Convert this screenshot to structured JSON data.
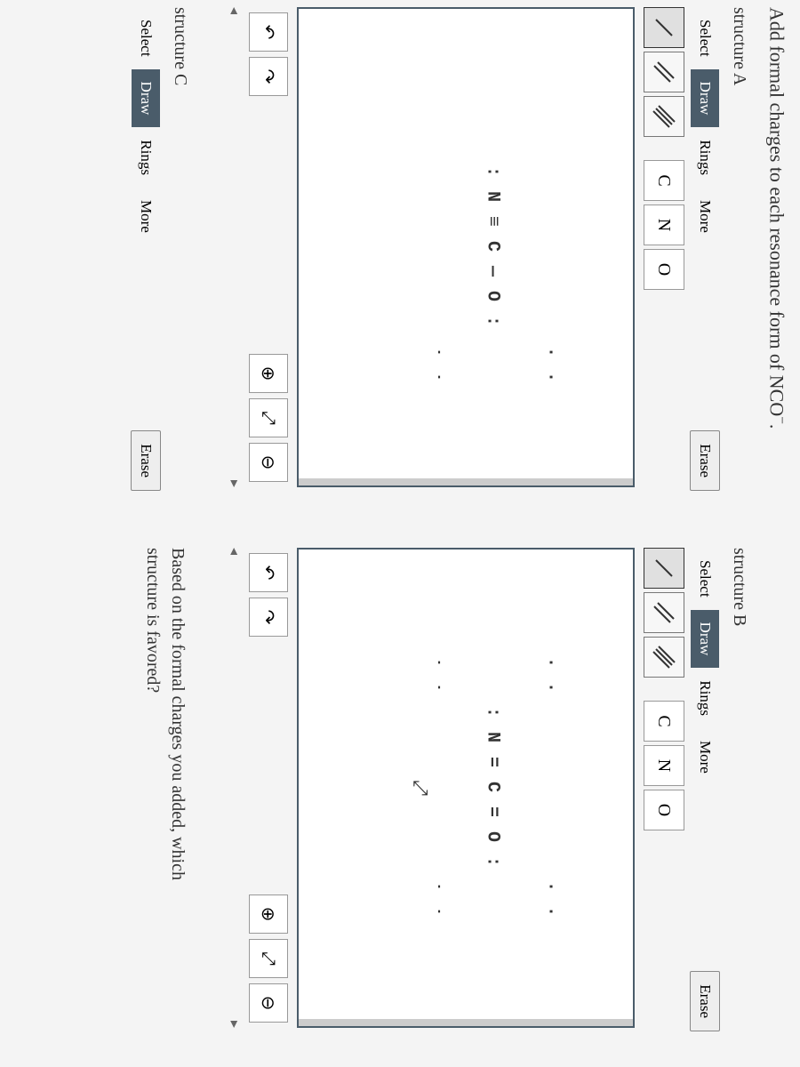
{
  "prompt_prefix": "Add formal charges to each resonance form of NCO",
  "prompt_suffix": ".",
  "charge_sup": "−",
  "structure_a": {
    "title": "structure A",
    "modes": {
      "select": "Select",
      "draw": "Draw",
      "rings": "Rings",
      "more": "More"
    },
    "erase": "Erase",
    "atoms": {
      "c": "C",
      "n": "N",
      "o": "O"
    },
    "lewis_top": "                   . .",
    "lewis_mid": ": N ≡ C — O :",
    "lewis_bottom": "                   ˙ ˙",
    "nav_left": "◂",
    "nav_right": "▸"
  },
  "structure_b": {
    "title": "structure B",
    "modes": {
      "select": "Select",
      "draw": "Draw",
      "rings": "Rings",
      "more": "More"
    },
    "erase": "Erase",
    "atoms": {
      "c": "C",
      "n": "N",
      "o": "O"
    },
    "lewis_top": ". .               . .",
    "lewis_mid": ": N = C = O :",
    "lewis_bottom": "˙ ˙               ˙ ˙",
    "cursor": "⤢",
    "nav_left": "◂",
    "nav_right": "▸"
  },
  "structure_c": {
    "title": "structure C",
    "modes": {
      "select": "Select",
      "draw": "Draw",
      "rings": "Rings",
      "more": "More"
    },
    "erase": "Erase"
  },
  "question_line1": "Based on the formal charges you added, which",
  "question_line2": "structure is favored?",
  "icons": {
    "undo": "↶",
    "redo": "↷",
    "zoom_in": "⊕",
    "zoom_fit": "⤢",
    "zoom_out": "⊖"
  }
}
